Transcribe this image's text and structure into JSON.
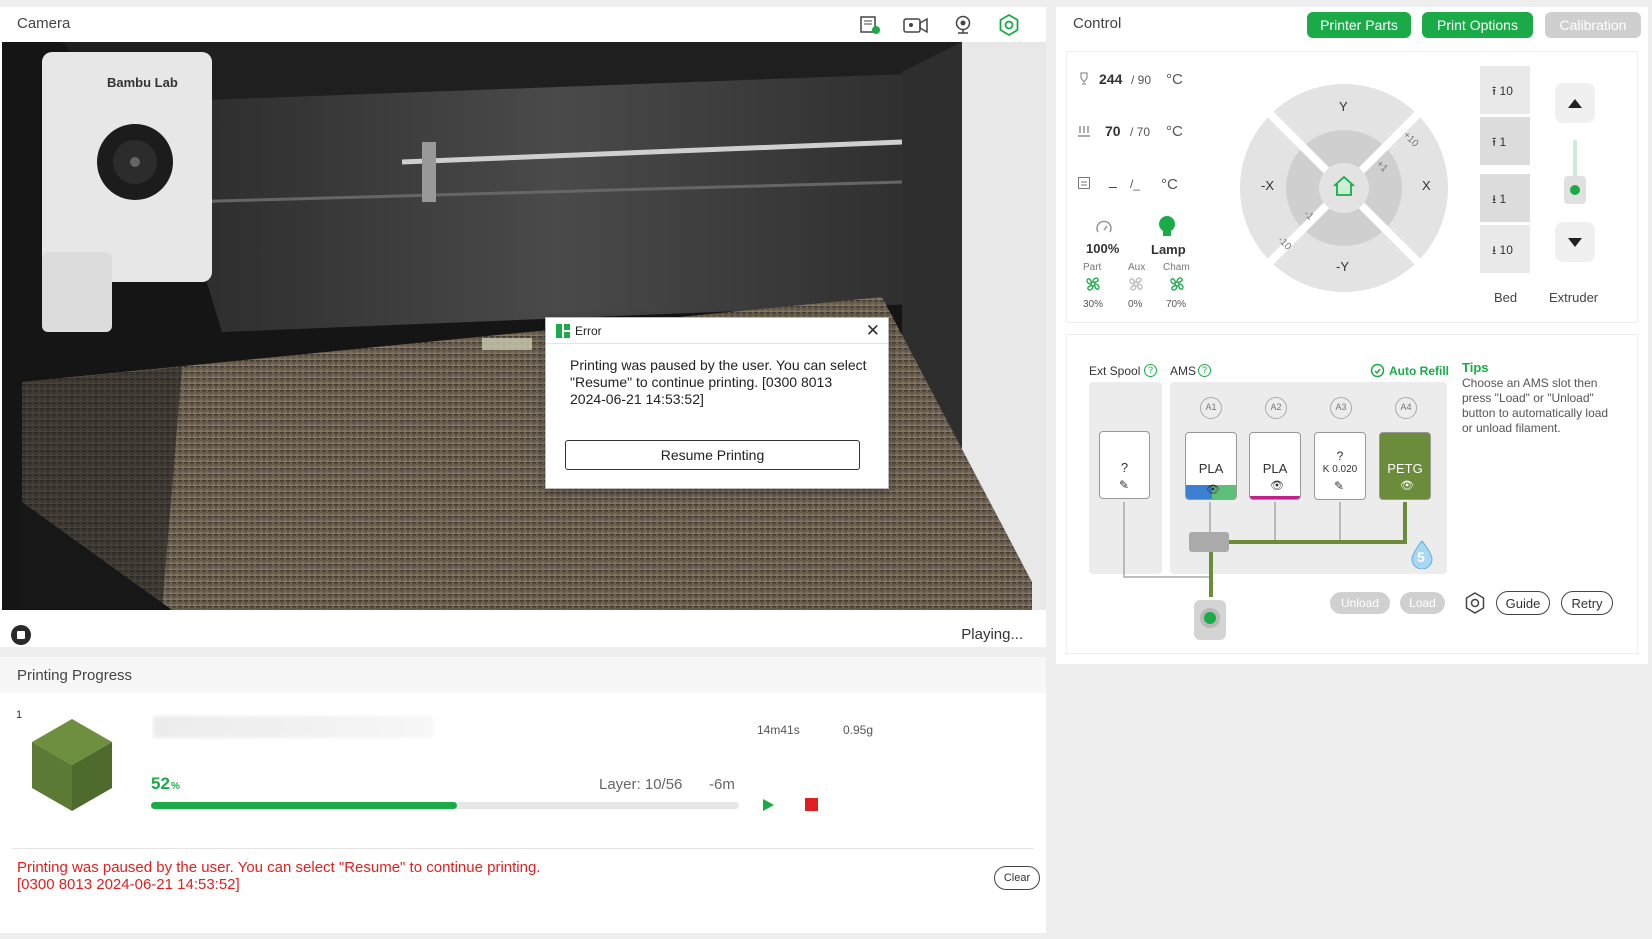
{
  "camera": {
    "title": "Camera",
    "status": "Playing...",
    "toolbar_icons": [
      "sd-card-icon",
      "video-recording-icon",
      "webcam-icon",
      "settings-icon"
    ]
  },
  "error_dialog": {
    "title": "Error",
    "message": "Printing was paused by the user. You can select \"Resume\" to continue printing. [0300 8013 2024-06-21 14:53:52]",
    "resume_label": "Resume Printing",
    "close_glyph": "✕"
  },
  "progress": {
    "title": "Printing Progress",
    "plate_number": "1",
    "time_estimate": "14m41s",
    "weight": "0.95g",
    "percent": "52",
    "percent_symbol": "%",
    "percent_value": 0.52,
    "layer": "Layer: 10/56",
    "remaining": "-6m",
    "log_line1": "Printing was paused by the user. You can select \"Resume\" to continue printing.",
    "log_line2": "[0300 8013 2024-06-21 14:53:52]",
    "clear_label": "Clear",
    "model_color": "#5c7a35"
  },
  "control": {
    "title": "Control",
    "buttons": {
      "printer_parts": "Printer Parts",
      "print_options": "Print Options",
      "calibration": "Calibration"
    },
    "nozzle": {
      "current": "244",
      "target": "/ 90",
      "unit": "°C"
    },
    "bed": {
      "current": "70",
      "target": "/ 70",
      "unit": "°C"
    },
    "chamber": {
      "current": "_",
      "target": "/_",
      "unit": "°C"
    },
    "speed": "100%",
    "lamp": "Lamp",
    "fans": [
      {
        "name": "Part",
        "value": "30%"
      },
      {
        "name": "Aux",
        "value": "0%"
      },
      {
        "name": "Cham",
        "value": "70%"
      }
    ],
    "jog": {
      "y_pos": "Y",
      "y_neg": "-Y",
      "x_pos": "X",
      "x_neg": "-X",
      "plus10": "+10",
      "plus1": "+1",
      "minus1": "-1",
      "minus10": "-10"
    },
    "z_steps": [
      "10",
      "1",
      "1",
      "10"
    ],
    "bed_label": "Bed",
    "extruder_label": "Extruder"
  },
  "ams": {
    "ext_spool_label": "Ext Spool",
    "ams_label": "AMS",
    "help_glyph": "?",
    "auto_refill": "Auto Refill",
    "tips_title": "Tips",
    "tips_text": "Choose an AMS slot then press \"Load\" or \"Unload\" button to automatically load or unload filament.",
    "ext_slot": "?",
    "slot_ids": [
      "A1",
      "A2",
      "A3",
      "A4"
    ],
    "slots": [
      {
        "material": "PLA",
        "color": "#3d7fd1",
        "color2": "#5cc07a"
      },
      {
        "material": "PLA",
        "color": "#c0208a"
      },
      {
        "material": "?",
        "sub": "K 0.020"
      },
      {
        "material": "PETG",
        "color": "#6b8c3a"
      }
    ],
    "humidity": "5",
    "unload_label": "Unload",
    "load_label": "Load",
    "guide_label": "Guide",
    "retry_label": "Retry"
  }
}
